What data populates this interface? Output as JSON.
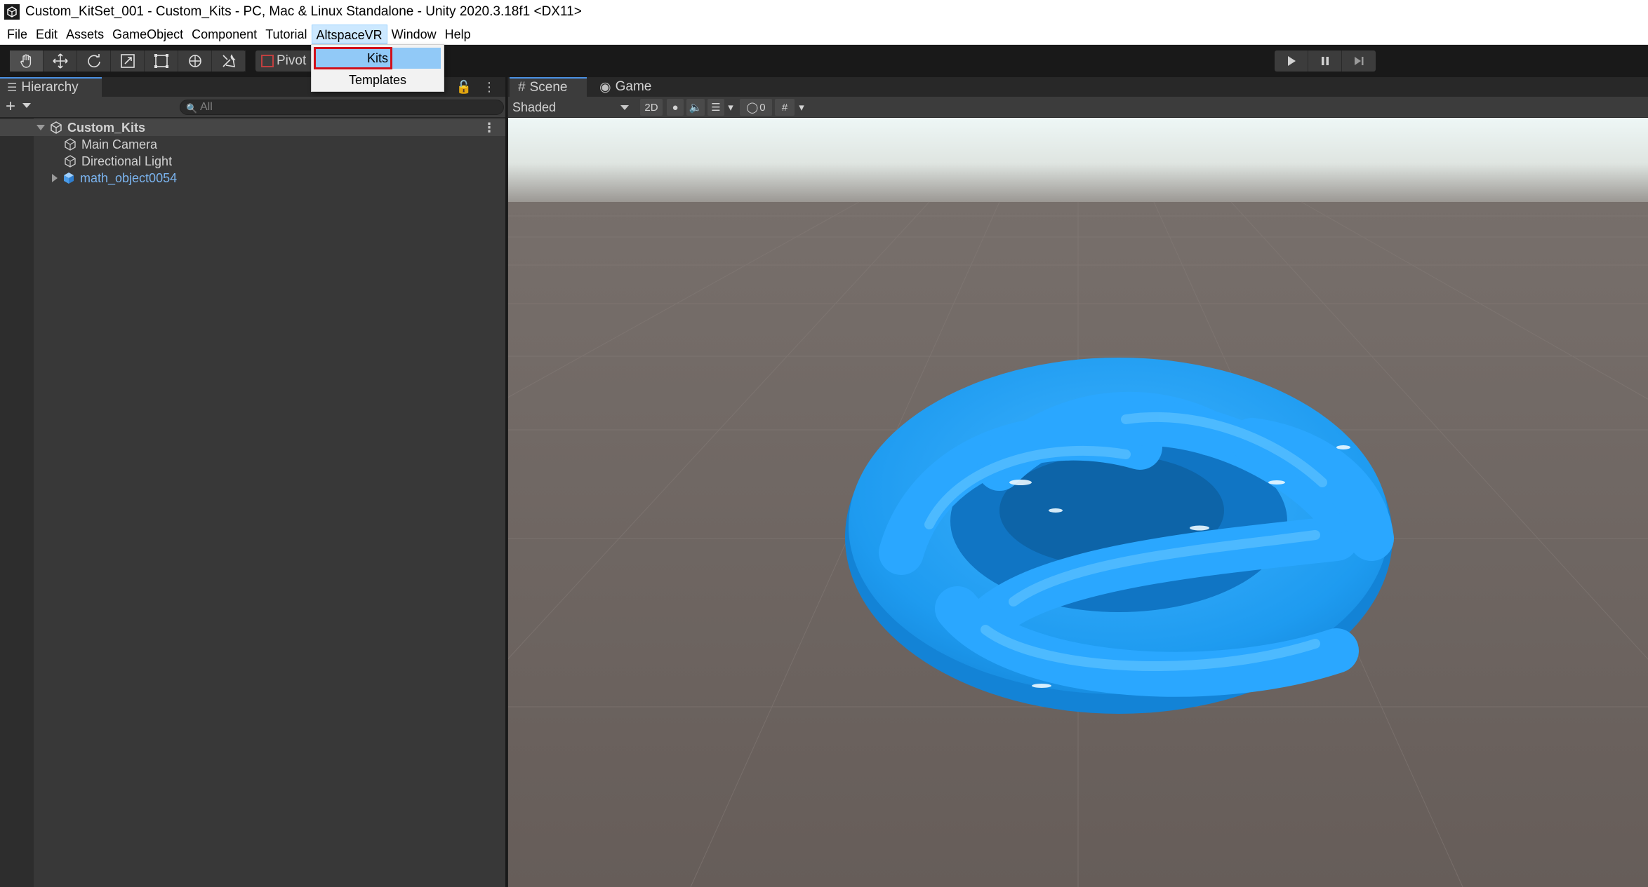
{
  "window": {
    "title": "Custom_KitSet_001 - Custom_Kits - PC, Mac & Linux Standalone - Unity 2020.3.18f1 <DX11>"
  },
  "menubar": {
    "items": [
      "File",
      "Edit",
      "Assets",
      "GameObject",
      "Component",
      "Tutorial",
      "AltspaceVR",
      "Window",
      "Help"
    ],
    "active": "AltspaceVR"
  },
  "dropdown": {
    "items": [
      "Kits",
      "Templates"
    ],
    "highlighted": "Kits"
  },
  "toolbar": {
    "tools": [
      "hand-tool",
      "move-tool",
      "rotate-tool",
      "scale-tool",
      "rect-tool",
      "transform-tool",
      "custom-tool"
    ],
    "pivot_label": "Pivot"
  },
  "hierarchy": {
    "tab_label": "Hierarchy",
    "search_placeholder": "All",
    "scene_name": "Custom_Kits",
    "objects": [
      {
        "label": "Main Camera",
        "prefab": false
      },
      {
        "label": "Directional Light",
        "prefab": false
      },
      {
        "label": "math_object0054",
        "prefab": true
      }
    ]
  },
  "scene": {
    "tabs": [
      "Scene",
      "Game"
    ],
    "shading_mode": "Shaded",
    "mode_2d": "2D",
    "hidden_count": "0"
  },
  "colors": {
    "accent": "#4a90e2",
    "object_blue": "#1e9bf0",
    "ground": "#6b625e",
    "sky": "#eef7f6",
    "highlight_box": "#d0101a"
  }
}
